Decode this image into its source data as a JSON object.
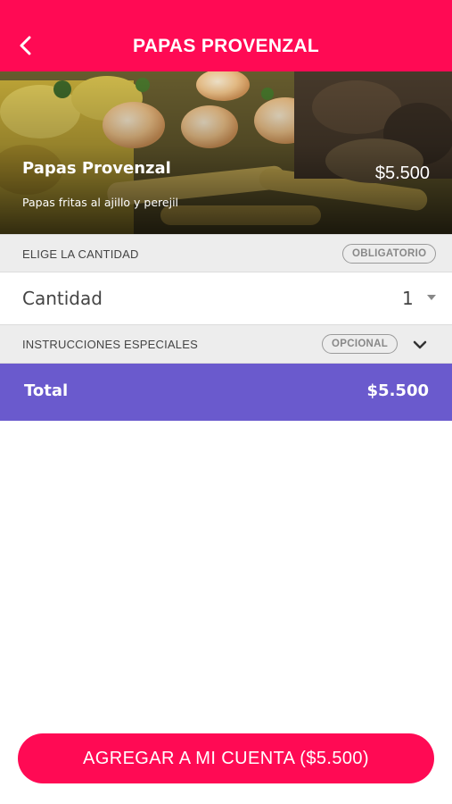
{
  "header": {
    "title": "PAPAS PROVENZAL",
    "back_icon": "chevron-left-icon",
    "background_color": "#ff0a54"
  },
  "product": {
    "name": "Papas Provenzal",
    "price": "$5.500",
    "description": "Papas fritas al ajillo y perejil"
  },
  "quantity_section": {
    "label": "ELIGE LA CANTIDAD",
    "badge": "OBLIGATORIO",
    "field_label": "Cantidad",
    "value": "1",
    "caret_icon": "caret-down-icon"
  },
  "instructions_section": {
    "label": "INSTRUCCIONES ESPECIALES",
    "badge": "OPCIONAL",
    "toggle_icon": "chevron-down-icon"
  },
  "total": {
    "label": "Total",
    "value": "$5.500",
    "background_color": "#6a5acd"
  },
  "cta": {
    "label": "AGREGAR A MI CUENTA ($5.500)"
  }
}
